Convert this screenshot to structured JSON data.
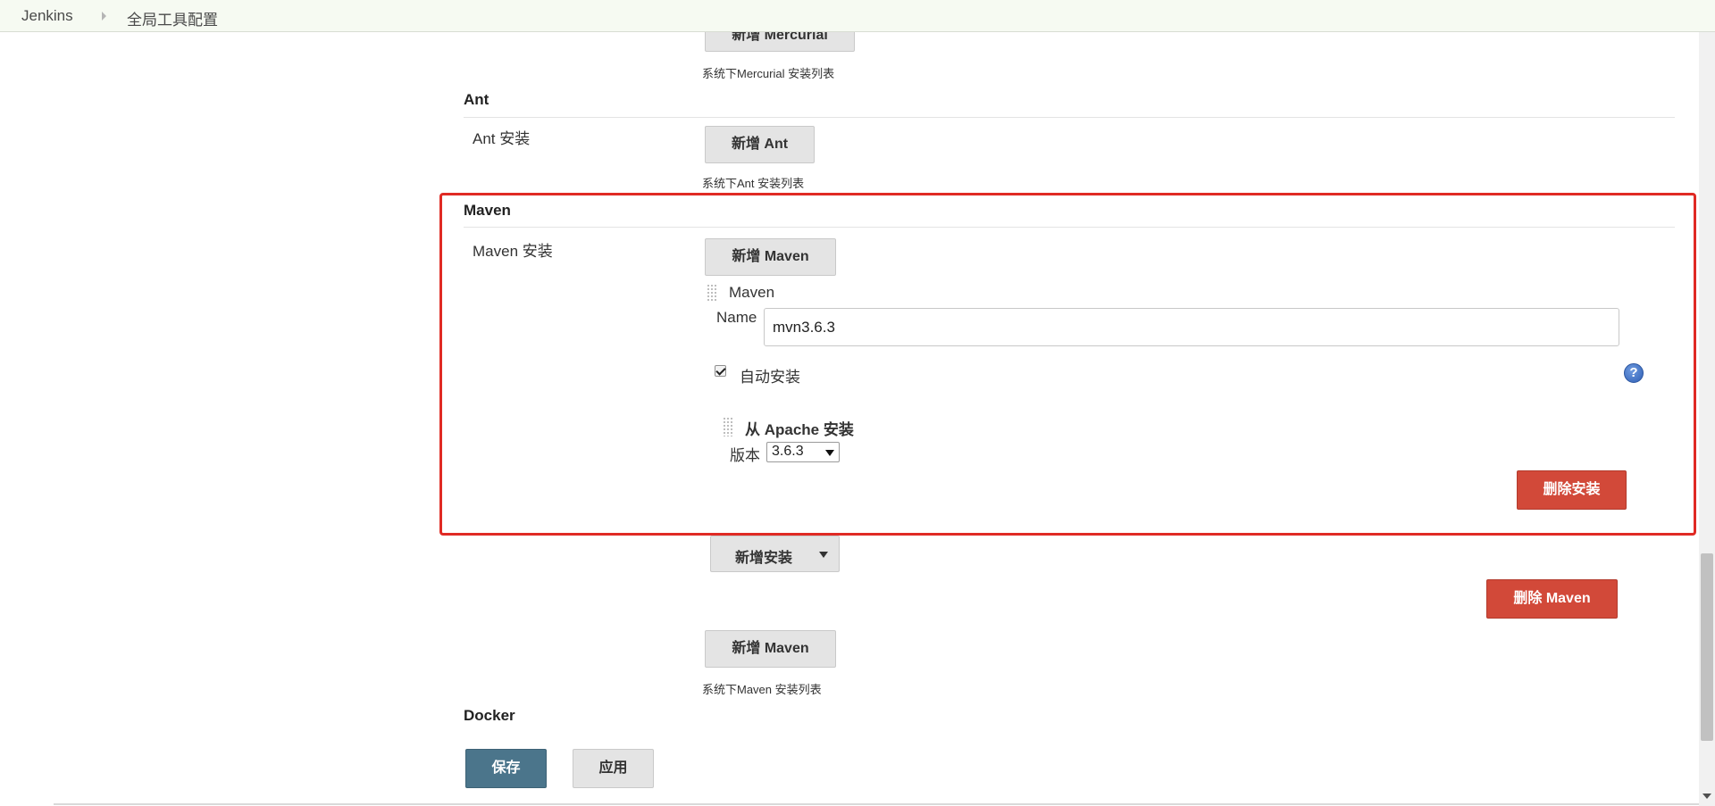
{
  "breadcrumb": {
    "items": [
      "Jenkins",
      "全局工具配置"
    ]
  },
  "mercurial": {
    "add_button_partial": "新增 Mercurial",
    "description": "系统下Mercurial 安装列表"
  },
  "ant": {
    "section_title": "Ant",
    "row_label": "Ant 安装",
    "add_button": "新增 Ant",
    "description": "系统下Ant 安装列表"
  },
  "maven": {
    "section_title": "Maven",
    "row_label": "Maven 安装",
    "add_button": "新增 Maven",
    "installation": {
      "header": "Maven",
      "name_label": "Name",
      "name_value": "mvn3.6.3",
      "auto_install_label": "自动安装",
      "auto_install_checked": true,
      "help_icon": "question-mark-icon",
      "installer": {
        "title": "从 Apache 安装",
        "version_label": "版本",
        "version_value": "3.6.3",
        "delete_installer_button": "删除安装"
      },
      "add_installer_button": "新增安装",
      "delete_maven_button": "删除 Maven"
    },
    "add_button_bottom": "新增 Maven",
    "description": "系统下Maven 安装列表"
  },
  "docker": {
    "section_title": "Docker"
  },
  "footer": {
    "save_button": "保存",
    "apply_button": "应用"
  },
  "colors": {
    "highlight": "#e02a24",
    "danger": "#d24939",
    "primary": "#4b758b",
    "breadcrumb_bg": "#f6faf2"
  }
}
